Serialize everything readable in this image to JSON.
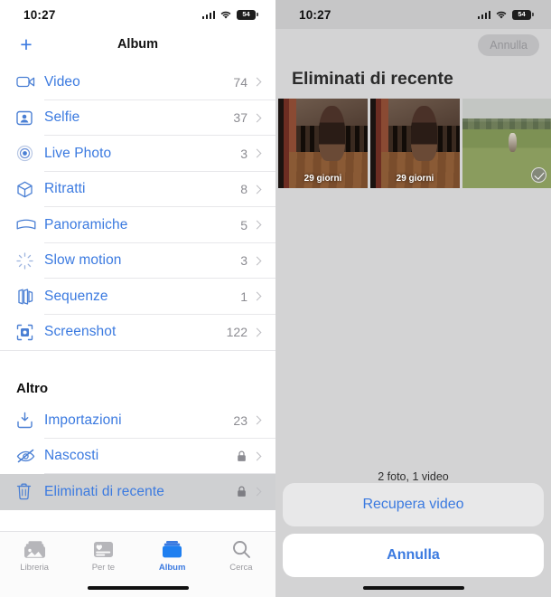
{
  "status_bar": {
    "time": "10:27",
    "battery_level": "54",
    "wifi_icon": "wifi-icon",
    "signal_icon": "cellular-signal-icon"
  },
  "left_pane": {
    "nav": {
      "add_label": "+",
      "title": "Album"
    },
    "albums": [
      {
        "icon": "video-camera-icon",
        "label": "Video",
        "count": "74"
      },
      {
        "icon": "person-portrait-icon",
        "label": "Selfie",
        "count": "37"
      },
      {
        "icon": "live-photo-icon",
        "label": "Live Photo",
        "count": "3"
      },
      {
        "icon": "cube-icon",
        "label": "Ritratti",
        "count": "8"
      },
      {
        "icon": "panorama-icon",
        "label": "Panoramiche",
        "count": "5"
      },
      {
        "icon": "slow-motion-icon",
        "label": "Slow motion",
        "count": "3"
      },
      {
        "icon": "burst-stack-icon",
        "label": "Sequenze",
        "count": "1"
      },
      {
        "icon": "screenshot-icon",
        "label": "Screenshot",
        "count": "122"
      }
    ],
    "other_section": {
      "title": "Altro",
      "items": [
        {
          "icon": "import-tray-icon",
          "label": "Importazioni",
          "count": "23",
          "locked": false,
          "selected": false
        },
        {
          "icon": "eye-slash-icon",
          "label": "Nascosti",
          "count": "",
          "locked": true,
          "selected": false
        },
        {
          "icon": "trash-icon",
          "label": "Eliminati di recente",
          "count": "",
          "locked": true,
          "selected": true
        }
      ]
    },
    "tabs": [
      {
        "icon": "photo-stack-icon",
        "label": "Libreria",
        "active": false
      },
      {
        "icon": "for-you-card-icon",
        "label": "Per te",
        "active": false
      },
      {
        "icon": "albums-box-icon",
        "label": "Album",
        "active": true
      },
      {
        "icon": "search-icon",
        "label": "Cerca",
        "active": false
      }
    ]
  },
  "right_pane": {
    "cancel_pill_label": "Annulla",
    "title": "Eliminati di recente",
    "thumbnails": [
      {
        "name": "dog-in-doorway-photo",
        "days_label": "29 giorni",
        "selected": false
      },
      {
        "name": "dog-in-doorway-photo",
        "days_label": "29 giorni",
        "selected": false
      },
      {
        "name": "dog-in-field-video",
        "days_label": "",
        "selected": true
      }
    ],
    "selection_count": "2 foto, 1 video",
    "action_sheet": {
      "recover_label": "Recupera video",
      "cancel_label": "Annulla"
    }
  }
}
